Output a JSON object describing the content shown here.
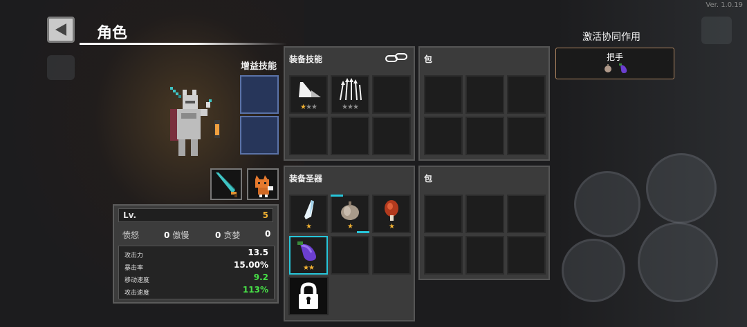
{
  "version": "Ver. 1.0.19",
  "header": {
    "title": "角色"
  },
  "buff": {
    "label": "增益技能"
  },
  "skills_panel": {
    "title": "装备技能",
    "slots": [
      {
        "icon": "blade-slash-icon",
        "stars": [
          1,
          0,
          0
        ]
      },
      {
        "icon": "arrow-volley-icon",
        "stars": [
          0,
          0,
          0
        ]
      }
    ]
  },
  "bag_top": {
    "title": "包"
  },
  "relics_panel": {
    "title": "装备圣器",
    "slots": [
      {
        "icon": "ice-shard-icon",
        "stars": [
          1
        ]
      },
      {
        "icon": "garlic-icon",
        "stars": [
          1
        ]
      },
      {
        "icon": "meat-icon",
        "stars": [
          1
        ]
      },
      {
        "icon": "eggplant-icon",
        "stars": [
          1,
          1
        ]
      }
    ]
  },
  "bag_bottom": {
    "title": "包"
  },
  "synergy": {
    "title": "激活协同作用",
    "name": "把手",
    "items": [
      "garlic-icon",
      "eggplant-icon"
    ]
  },
  "stats": {
    "lv_label": "Lv.",
    "lv_value": "5",
    "sins": [
      {
        "label": "愤怒",
        "value": "0"
      },
      {
        "label": "傲慢",
        "value": "0"
      },
      {
        "label": "贪婪",
        "value": "0"
      }
    ],
    "attrs": [
      {
        "label": "攻击力",
        "value": "13.5",
        "color": "#ffffff"
      },
      {
        "label": "暴击率",
        "value": "15.00%",
        "color": "#ffffff"
      },
      {
        "label": "移动速度",
        "value": "9.2",
        "color": "#47e047"
      },
      {
        "label": "攻击速度",
        "value": "113%",
        "color": "#47e047"
      }
    ]
  },
  "colors": {
    "accent_gold": "#f2b233",
    "highlight_cyan": "#26c6da",
    "buff_blue": "#27365a",
    "bonus_green": "#47e047"
  }
}
